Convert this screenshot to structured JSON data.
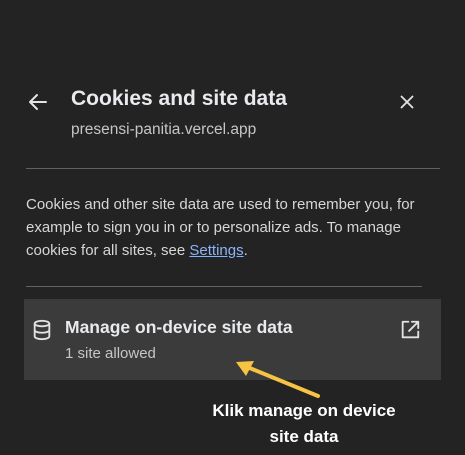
{
  "header": {
    "title": "Cookies and site data",
    "subtitle": "presensi-panitia.vercel.app",
    "back_icon": "arrow-left-icon",
    "close_icon": "close-icon"
  },
  "description": {
    "text_before_link": "Cookies and other site data are used to remember you, for example to sign you in or to personalize ads. To manage cookies for all sites, see ",
    "link_label": "Settings",
    "text_after_link": "."
  },
  "manage_item": {
    "title": "Manage on-device site data",
    "subtitle": "1 site allowed",
    "icon": "database-icon",
    "trailing_icon": "external-link-icon"
  },
  "annotation": {
    "line1": "Klik manage on device",
    "line2": "site data",
    "arrow_color": "#f6c343"
  },
  "colors": {
    "background": "#232323",
    "row_background": "#3b3b3b",
    "link": "#8ab4f8"
  }
}
